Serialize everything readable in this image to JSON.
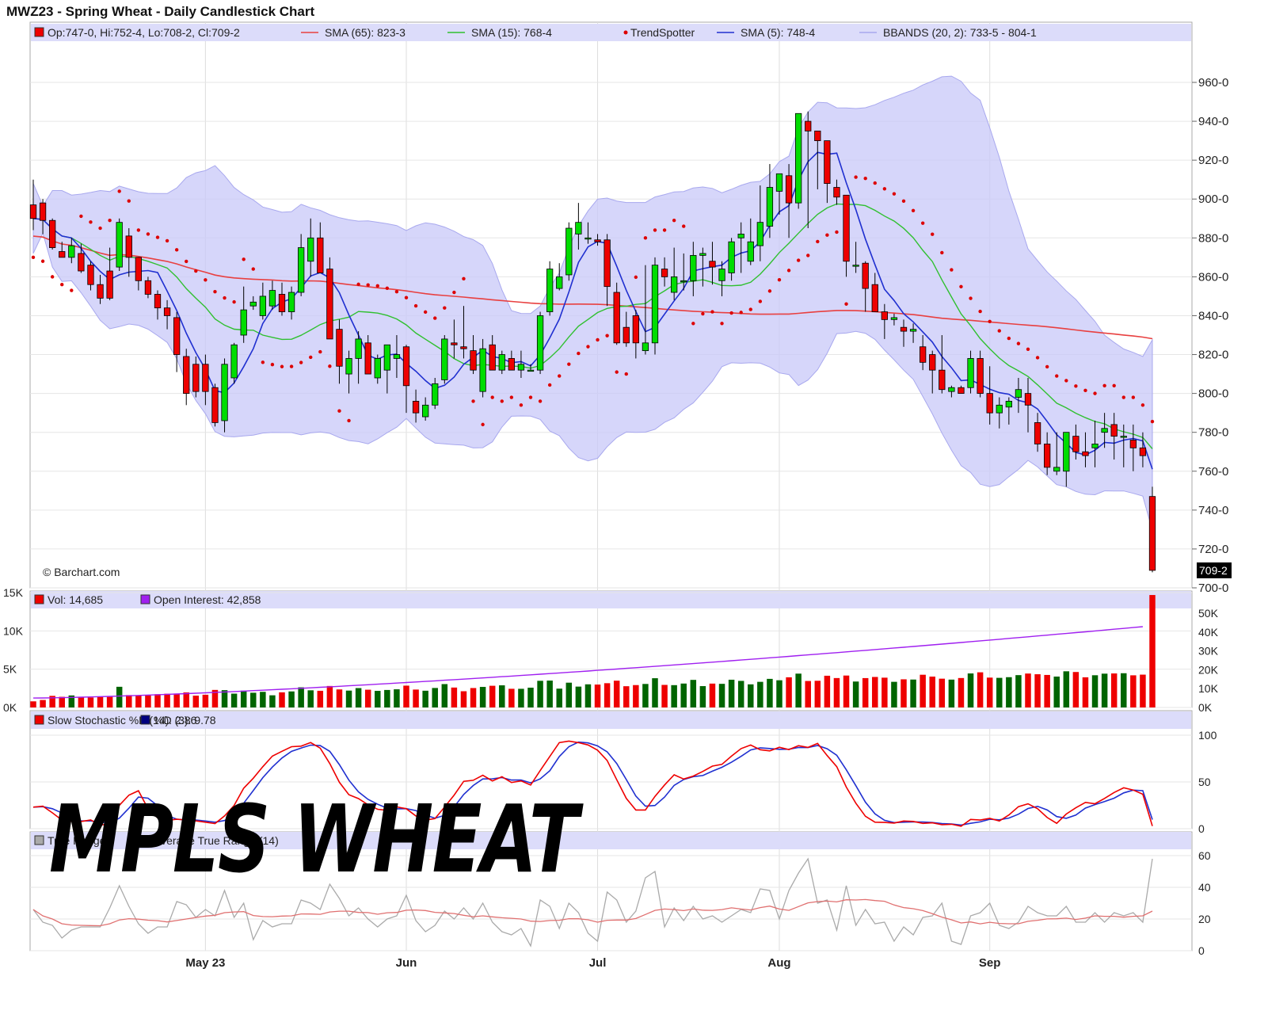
{
  "title": "MWZ23 - Spring Wheat - Daily Candlestick Chart",
  "watermark": "© Barchart.com",
  "overlay_text": "MPLS WHEAT",
  "last_price_label": "709-2",
  "colors": {
    "up": "#00dd00",
    "down": "#ee0000",
    "sma65": "#e84040",
    "sma15": "#30c030",
    "sma5": "#2030d0",
    "trendspotter": "#dd0000",
    "bbands": "#c8c8f8",
    "oi": "#a020f0",
    "vol_up": "#006400",
    "vol_down": "#ee0000",
    "stoch_k": "#ee0000",
    "stoch_d": "#2030d0",
    "tr": "#aaaaaa",
    "atr": "#e07070",
    "legend_bg": "#dcdcfa"
  },
  "legend": {
    "price": [
      {
        "icon": "red-box",
        "text": "Op:747-0, Hi:752-4, Lo:708-2, Cl:709-2"
      },
      {
        "icon": "line-red",
        "text": "SMA (65): 823-3"
      },
      {
        "icon": "line-green",
        "text": "SMA (15): 768-4"
      },
      {
        "icon": "dot-red",
        "text": "TrendSpotter"
      },
      {
        "icon": "line-blue",
        "text": "SMA (5): 748-4"
      },
      {
        "icon": "line-lavender",
        "text": "BBANDS (20, 2): 733-5 - 804-1"
      }
    ],
    "volume": [
      {
        "icon": "red-box",
        "text": "Vol: 14,685"
      },
      {
        "icon": "purple-box",
        "text": "Open Interest: 42,858"
      }
    ],
    "stochastic": [
      {
        "icon": "red-box",
        "text": "Slow Stochastic %K (14): 2.86"
      },
      {
        "icon": "navy-box",
        "text": "%D (3): 9.78"
      }
    ],
    "atr": [
      {
        "icon": "gray-box",
        "text": "True Range"
      },
      {
        "icon": "pink-box",
        "text": "Average True Range (14)"
      }
    ]
  },
  "x_axis": {
    "month_labels": [
      "May 23",
      "Jun",
      "Jul",
      "Aug",
      "Sep"
    ]
  },
  "panels": {
    "price": {
      "ylim": [
        700,
        980
      ],
      "ticks": [
        "960-0",
        "940-0",
        "920-0",
        "900-0",
        "880-0",
        "860-0",
        "840-0",
        "820-0",
        "800-0",
        "780-0",
        "760-0",
        "740-0",
        "720-0",
        "700-0"
      ]
    },
    "volume": {
      "left_ticks": [
        "15K",
        "10K",
        "5K",
        "0K"
      ],
      "right_ticks": [
        "50K",
        "40K",
        "30K",
        "20K",
        "10K",
        "0K"
      ]
    },
    "stochastic": {
      "ticks": [
        "100",
        "50",
        "0"
      ]
    },
    "atr": {
      "ticks": [
        "60",
        "40",
        "20",
        "0"
      ]
    }
  },
  "chart_data": {
    "type": "candlestick",
    "title": "MWZ23 - Spring Wheat - Daily Candlestick Chart",
    "bars": 118,
    "month_starts": [
      {
        "label": "May 23",
        "index": 18
      },
      {
        "label": "Jun",
        "index": 39
      },
      {
        "label": "Jul",
        "index": 59
      },
      {
        "label": "Aug",
        "index": 78
      },
      {
        "label": "Sep",
        "index": 100
      }
    ],
    "ohlc": [
      [
        897,
        910,
        884,
        890
      ],
      [
        898,
        900,
        882,
        889
      ],
      [
        889,
        890,
        874,
        875
      ],
      [
        873,
        878,
        870,
        870
      ],
      [
        870,
        880,
        867,
        876
      ],
      [
        872,
        877,
        862,
        863
      ],
      [
        866,
        868,
        853,
        856
      ],
      [
        856,
        861,
        846,
        849
      ],
      [
        863,
        875,
        848,
        849
      ],
      [
        865,
        890,
        863,
        888
      ],
      [
        881,
        885,
        860,
        870
      ],
      [
        870,
        870,
        853,
        858
      ],
      [
        858,
        860,
        849,
        851
      ],
      [
        851,
        853,
        838,
        844
      ],
      [
        844,
        848,
        833,
        840
      ],
      [
        839,
        842,
        811,
        820
      ],
      [
        819,
        823,
        794,
        800
      ],
      [
        815,
        819,
        798,
        801
      ],
      [
        815,
        820,
        794,
        801
      ],
      [
        803,
        805,
        783,
        785
      ],
      [
        786,
        818,
        780,
        815
      ],
      [
        808,
        826,
        805,
        825
      ],
      [
        830,
        855,
        826,
        843
      ],
      [
        845,
        850,
        843,
        847
      ],
      [
        840,
        857,
        838,
        850
      ],
      [
        845,
        858,
        843,
        853
      ],
      [
        851,
        857,
        840,
        842
      ],
      [
        842,
        855,
        838,
        852
      ],
      [
        852,
        882,
        850,
        875
      ],
      [
        868,
        890,
        860,
        880
      ],
      [
        880,
        888,
        862,
        862
      ],
      [
        864,
        870,
        828,
        828
      ],
      [
        833,
        838,
        805,
        814
      ],
      [
        810,
        822,
        800,
        818
      ],
      [
        818,
        832,
        805,
        828
      ],
      [
        826,
        830,
        810,
        810
      ],
      [
        808,
        820,
        805,
        818
      ],
      [
        812,
        820,
        800,
        825
      ],
      [
        818,
        830,
        808,
        820
      ],
      [
        824,
        825,
        790,
        804
      ],
      [
        796,
        802,
        785,
        790
      ],
      [
        788,
        798,
        786,
        794
      ],
      [
        794,
        808,
        792,
        805
      ],
      [
        807,
        830,
        805,
        828
      ],
      [
        826,
        838,
        818,
        825
      ],
      [
        824,
        845,
        818,
        823
      ],
      [
        822,
        830,
        810,
        812
      ],
      [
        801,
        828,
        798,
        823
      ],
      [
        825,
        830,
        812,
        812
      ],
      [
        812,
        822,
        810,
        820
      ],
      [
        818,
        822,
        812,
        812
      ],
      [
        812,
        822,
        808,
        815
      ],
      [
        812,
        815,
        812,
        812
      ],
      [
        812,
        842,
        810,
        840
      ],
      [
        842,
        868,
        840,
        864
      ],
      [
        854,
        867,
        853,
        860
      ],
      [
        861,
        888,
        858,
        885
      ],
      [
        882,
        898,
        874,
        888
      ],
      [
        880,
        888,
        877,
        880
      ],
      [
        879,
        882,
        876,
        878
      ],
      [
        879,
        882,
        845,
        855
      ],
      [
        852,
        857,
        825,
        826
      ],
      [
        834,
        842,
        824,
        826
      ],
      [
        840,
        843,
        818,
        826
      ],
      [
        822,
        866,
        820,
        826
      ],
      [
        826,
        870,
        820,
        866
      ],
      [
        864,
        870,
        855,
        860
      ],
      [
        852,
        875,
        848,
        860
      ],
      [
        858,
        872,
        853,
        858
      ],
      [
        858,
        878,
        850,
        871
      ],
      [
        871,
        875,
        855,
        872
      ],
      [
        868,
        878,
        856,
        865
      ],
      [
        858,
        868,
        850,
        864
      ],
      [
        862,
        880,
        858,
        878
      ],
      [
        880,
        888,
        862,
        882
      ],
      [
        868,
        890,
        866,
        878
      ],
      [
        876,
        907,
        868,
        888
      ],
      [
        886,
        918,
        880,
        906
      ],
      [
        904,
        912,
        892,
        913
      ],
      [
        912,
        918,
        880,
        898
      ],
      [
        898,
        944,
        895,
        944
      ],
      [
        940,
        945,
        885,
        935
      ],
      [
        935,
        930,
        905,
        930
      ],
      [
        930,
        908,
        898,
        908
      ],
      [
        906,
        910,
        897,
        901
      ],
      [
        902,
        883,
        860,
        868
      ],
      [
        866,
        878,
        862,
        866
      ],
      [
        867,
        868,
        842,
        854
      ],
      [
        856,
        862,
        845,
        842
      ],
      [
        842,
        846,
        828,
        838
      ],
      [
        838,
        841,
        835,
        839
      ],
      [
        834,
        838,
        824,
        832
      ],
      [
        832,
        836,
        826,
        833
      ],
      [
        824,
        830,
        812,
        816
      ],
      [
        820,
        822,
        800,
        812
      ],
      [
        812,
        830,
        800,
        802
      ],
      [
        801,
        804,
        798,
        803
      ],
      [
        803,
        804,
        800,
        800
      ],
      [
        803,
        822,
        800,
        818
      ],
      [
        818,
        822,
        798,
        800
      ],
      [
        800,
        814,
        784,
        790
      ],
      [
        790,
        798,
        782,
        794
      ],
      [
        793,
        798,
        784,
        796
      ],
      [
        798,
        808,
        790,
        802
      ],
      [
        800,
        808,
        780,
        794
      ],
      [
        785,
        790,
        770,
        774
      ],
      [
        774,
        780,
        758,
        762
      ],
      [
        760,
        780,
        758,
        762
      ],
      [
        760,
        780,
        752,
        780
      ],
      [
        778,
        784,
        766,
        770
      ],
      [
        770,
        780,
        762,
        768
      ],
      [
        772,
        786,
        762,
        774
      ],
      [
        780,
        790,
        772,
        782
      ],
      [
        784,
        790,
        766,
        778
      ],
      [
        778,
        784,
        762,
        778
      ],
      [
        776,
        784,
        760,
        772
      ],
      [
        772,
        780,
        762,
        768
      ],
      [
        747,
        752,
        708,
        709
      ]
    ],
    "sma65": {
      "start": 876,
      "end": 823.375
    },
    "sma15_last": 768.5,
    "sma5_last": 748.5,
    "bbands_last": {
      "lower": 733.625,
      "upper": 804.125
    },
    "volume_last": 14685,
    "open_interest_last": 42858,
    "stoch_k_last": 2.86,
    "stoch_d_last": 9.78
  }
}
